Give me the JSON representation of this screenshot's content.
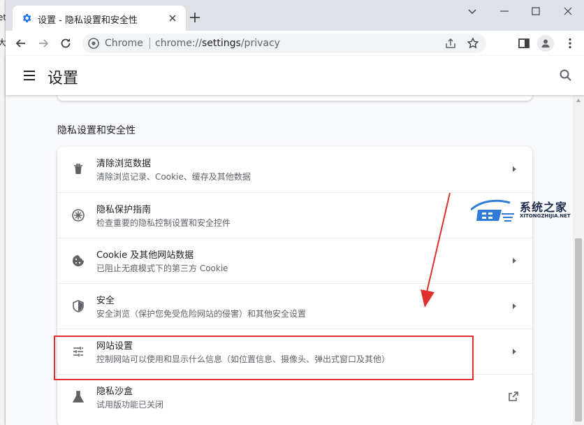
{
  "outer_left_chars": [
    "et",
    "大"
  ],
  "tab": {
    "title": "设置 - 隐私设置和安全性"
  },
  "omnibox": {
    "site": "Chrome",
    "url_host": "chrome://",
    "url_path": "settings",
    "url_rest": "/privacy"
  },
  "header": {
    "title": "设置"
  },
  "section": {
    "title": "隐私设置和安全性"
  },
  "rows": [
    {
      "title": "清除浏览数据",
      "subtitle": "清除浏览记录、Cookie、缓存及其他数据",
      "icon": "trash-icon"
    },
    {
      "title": "隐私保护指南",
      "subtitle": "检查重要的隐私控制设置和安全控件",
      "icon": "privacy-guide-icon"
    },
    {
      "title": "Cookie 及其他网站数据",
      "subtitle": "已阻止无痕模式下的第三方 Cookie",
      "icon": "cookie-icon"
    },
    {
      "title": "安全",
      "subtitle": "安全浏览（保护您免受危险网站的侵害）和其他安全设置",
      "icon": "shield-icon"
    },
    {
      "title": "网站设置",
      "subtitle": "控制网站可以使用和显示什么信息（如位置信息、摄像头、弹出式窗口及其他）",
      "icon": "tune-icon"
    },
    {
      "title": "隐私沙盒",
      "subtitle": "试用版功能已关闭",
      "icon": "flask-icon"
    }
  ],
  "watermark": {
    "cn": "系统之家",
    "en": "XITONGZHIJIA.NET"
  },
  "colors": {
    "accent": "#1a73e8",
    "annotation": "#e0302e",
    "tabstrip": "#dee1e6",
    "page_bg": "#f8f9fa"
  }
}
